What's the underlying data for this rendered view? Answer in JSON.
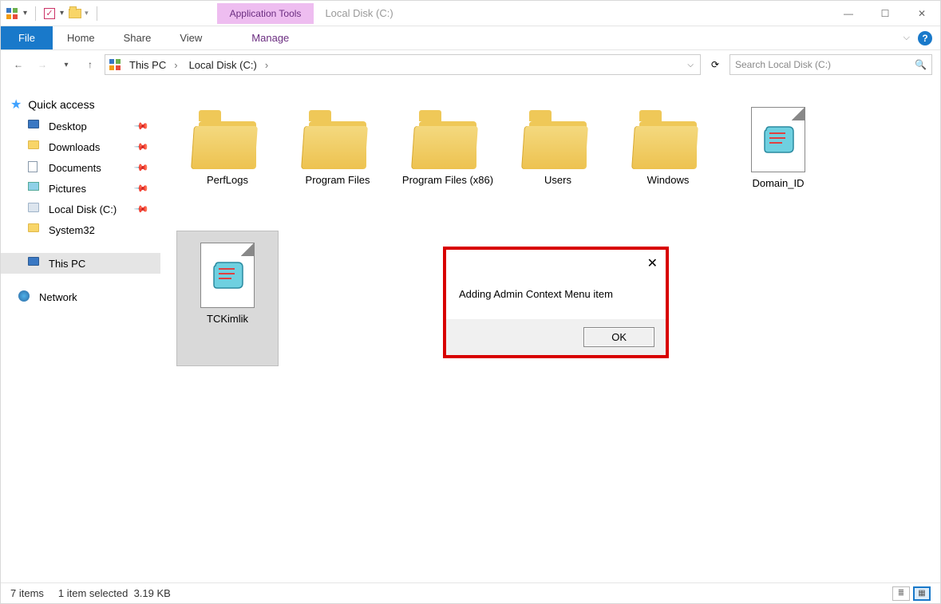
{
  "titlebar": {
    "context_label": "Application Tools",
    "window_title": "Local Disk (C:)"
  },
  "ribbon": {
    "file": "File",
    "tabs": [
      "Home",
      "Share",
      "View"
    ],
    "context_tab": "Manage"
  },
  "breadcrumb": {
    "items": [
      "This PC",
      "Local Disk (C:)"
    ]
  },
  "search": {
    "placeholder": "Search Local Disk (C:)"
  },
  "navpane": {
    "quick_access": "Quick access",
    "quick_items": [
      {
        "label": "Desktop",
        "icon": "desktop"
      },
      {
        "label": "Downloads",
        "icon": "folder"
      },
      {
        "label": "Documents",
        "icon": "doc"
      },
      {
        "label": "Pictures",
        "icon": "pic"
      },
      {
        "label": "Local Disk (C:)",
        "icon": "disk"
      },
      {
        "label": "System32",
        "icon": "folder"
      }
    ],
    "this_pc": "This PC",
    "network": "Network"
  },
  "items": [
    {
      "name": "PerfLogs",
      "type": "folder"
    },
    {
      "name": "Program Files",
      "type": "folder"
    },
    {
      "name": "Program Files (x86)",
      "type": "folder"
    },
    {
      "name": "Users",
      "type": "folder"
    },
    {
      "name": "Windows",
      "type": "folder"
    },
    {
      "name": "Domain_ID",
      "type": "script"
    },
    {
      "name": "TCKimlik",
      "type": "script",
      "selected": true
    }
  ],
  "dialog": {
    "message": "Adding Admin Context Menu item",
    "ok": "OK"
  },
  "status": {
    "count": "7 items",
    "selection": "1 item selected",
    "size": "3.19 KB"
  }
}
